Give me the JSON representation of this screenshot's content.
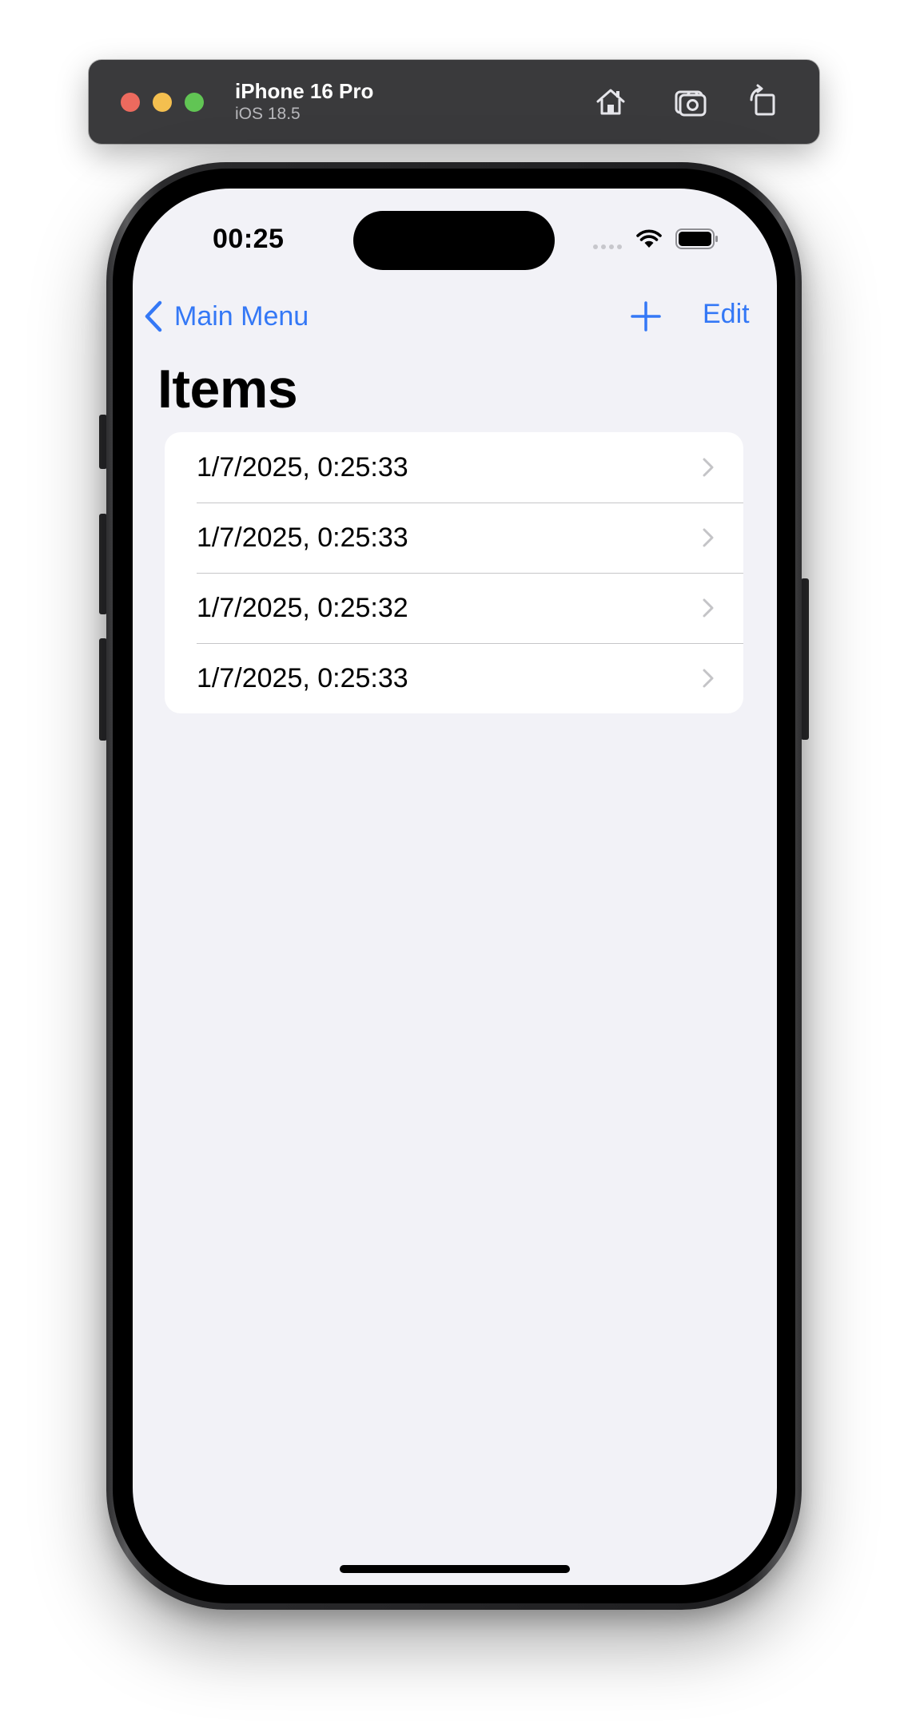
{
  "simulator": {
    "device_name": "iPhone 16 Pro",
    "os_version": "iOS 18.5",
    "toolbar_icons": [
      "home-icon",
      "screenshot-icon",
      "rotate-icon"
    ]
  },
  "status_bar": {
    "time": "00:25"
  },
  "nav_bar": {
    "back_label": "Main Menu",
    "edit_label": "Edit",
    "accent_color": "#3478f6"
  },
  "page": {
    "title": "Items",
    "background": "#f2f2f7"
  },
  "items": [
    {
      "label": "1/7/2025, 0:25:33"
    },
    {
      "label": "1/7/2025, 0:25:33"
    },
    {
      "label": "1/7/2025, 0:25:32"
    },
    {
      "label": "1/7/2025, 0:25:33"
    }
  ]
}
